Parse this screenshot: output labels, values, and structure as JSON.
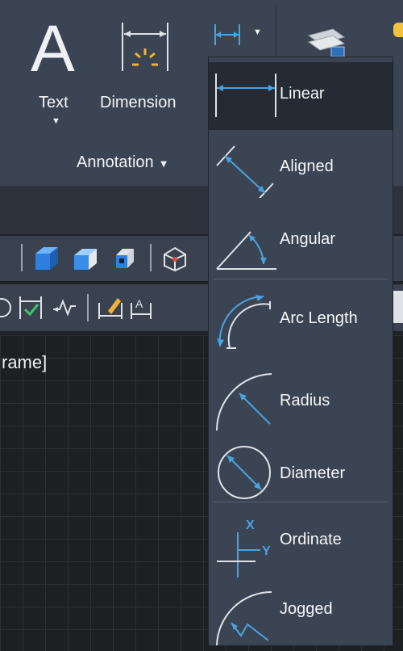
{
  "ribbon": {
    "text_button": {
      "icon_glyph": "A",
      "label": "Text"
    },
    "dimension_button": {
      "label": "Dimension"
    },
    "panel_title": "Annotation"
  },
  "canvas": {
    "partial_label": "rame]"
  },
  "dim_dropdown": {
    "selected": "Linear",
    "items": [
      {
        "label": "Linear",
        "icon": "linear-dimension-icon"
      },
      {
        "label": "Aligned",
        "icon": "aligned-dimension-icon"
      },
      {
        "label": "Angular",
        "icon": "angular-dimension-icon"
      },
      {
        "label": "Arc Length",
        "icon": "arc-length-dimension-icon"
      },
      {
        "label": "Radius",
        "icon": "radius-dimension-icon"
      },
      {
        "label": "Diameter",
        "icon": "diameter-dimension-icon"
      },
      {
        "label": "Ordinate",
        "icon": "ordinate-dimension-icon"
      },
      {
        "label": "Jogged",
        "icon": "jogged-dimension-icon"
      }
    ],
    "ordinate_axis_x": "X",
    "ordinate_axis_y": "Y"
  },
  "colors": {
    "ribbon_bg": "#3b4453",
    "menu_bg": "#3b4453",
    "selected_bg": "#242b34",
    "icon_blue": "#4aa3df",
    "canvas_bg": "#1d1f22"
  }
}
